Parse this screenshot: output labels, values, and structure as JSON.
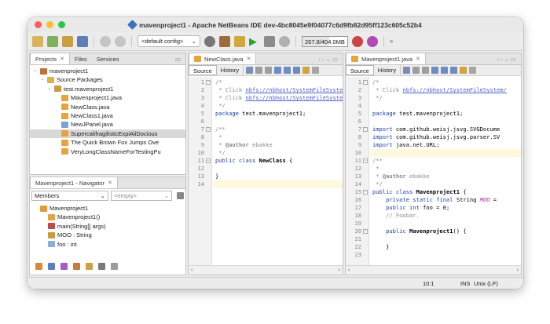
{
  "window": {
    "title": "mavenproject1 - Apache NetBeans IDE dev-4bc8045e9f04077c6d9fb82d95ff123c605c52b4",
    "traffic_colors": [
      "#ff5f57",
      "#febc2e",
      "#28c840"
    ]
  },
  "toolbar": {
    "config_label": "<default config>",
    "memory_label": "267.8/404.0MB",
    "more_label": "»"
  },
  "projects_panel": {
    "tabs": [
      {
        "label": "Projects",
        "close": "✕"
      },
      {
        "label": "Files"
      },
      {
        "label": "Services"
      }
    ],
    "tree": [
      {
        "label": "mavenproject1",
        "icon": "maven-project-icon",
        "depth": 0,
        "expanded": true
      },
      {
        "label": "Source Packages",
        "icon": "source-folder-icon",
        "depth": 1,
        "expanded": true
      },
      {
        "label": "test.mavenproject1",
        "icon": "package-icon",
        "depth": 2,
        "expanded": true
      },
      {
        "label": "Mavenproject1.java",
        "icon": "java-file-icon",
        "depth": 3
      },
      {
        "label": "NewClass.java",
        "icon": "java-file-icon",
        "depth": 3
      },
      {
        "label": "NewClass1.java",
        "icon": "java-file-icon",
        "depth": 3
      },
      {
        "label": "NewJPanel.java",
        "icon": "form-file-icon",
        "depth": 3
      },
      {
        "label": "SupercalifragilisticExpiAliDocious",
        "icon": "java-file-icon",
        "depth": 3,
        "selected": true
      },
      {
        "label": "The Quick Brown Fox Jumps Ove",
        "icon": "java-file-icon",
        "depth": 3
      },
      {
        "label": "VeryLongClassNameForTestingPu",
        "icon": "java-file-icon",
        "depth": 3
      }
    ]
  },
  "navigator_panel": {
    "title": "Mavenproject1 - Navigator",
    "close": "✕",
    "members_label": "Members",
    "empty_label": "<empty>",
    "tree": [
      {
        "label": "Mavenproject1",
        "icon": "class-icon",
        "depth": 0
      },
      {
        "label": "Mavenproject1()",
        "icon": "constructor-icon",
        "depth": 1
      },
      {
        "label": "main(String[] args)",
        "icon": "method-icon",
        "depth": 1
      },
      {
        "label": "MOO : String",
        "icon": "field-static-icon",
        "depth": 1
      },
      {
        "label": "foo : int",
        "icon": "field-icon",
        "depth": 1
      }
    ]
  },
  "editor_left": {
    "tab_label": "NewClass.java",
    "close": "✕",
    "source_label": "Source",
    "history_label": "History",
    "lines": [
      {
        "n": "1",
        "text": "/*"
      },
      {
        "n": "2",
        "text": " * Click nbfs://nbhost/SystemFileSystem/"
      },
      {
        "n": "3",
        "text": " * Click nbfs://nbhost/SystemFileSystem/"
      },
      {
        "n": "4",
        "text": " */"
      },
      {
        "n": "5",
        "text": "package test.mavenproject1;"
      },
      {
        "n": "6",
        "text": ""
      },
      {
        "n": "7",
        "text": "/**"
      },
      {
        "n": "8",
        "text": " *"
      },
      {
        "n": "9",
        "text": " * @author ebakke"
      },
      {
        "n": "10",
        "text": " */"
      },
      {
        "n": "11",
        "text": "public class NewClass {"
      },
      {
        "n": "12",
        "text": ""
      },
      {
        "n": "13",
        "text": "}"
      },
      {
        "n": "14",
        "text": ""
      }
    ]
  },
  "editor_right": {
    "tab_label": "Mavenproject1.java",
    "close": "✕",
    "source_label": "Source",
    "history_label": "History",
    "lines": [
      {
        "n": "1",
        "text": "/*"
      },
      {
        "n": "2",
        "text": " * Click nbfs://nbhost/SystemFileSystem/"
      },
      {
        "n": "3",
        "text": " */"
      },
      {
        "n": "4",
        "text": ""
      },
      {
        "n": "5",
        "text": "package test.mavenproject1;"
      },
      {
        "n": "6",
        "text": ""
      },
      {
        "n": "7",
        "text": "import com.github.weisj.jsvg.SVGDocume"
      },
      {
        "n": "8",
        "text": "import com.github.weisj.jsvg.parser.SV"
      },
      {
        "n": "9",
        "text": "import java.net.URL;"
      },
      {
        "n": "10",
        "text": ""
      },
      {
        "n": "11",
        "text": "/**"
      },
      {
        "n": "12",
        "text": " *"
      },
      {
        "n": "13",
        "text": " * @author ebakke"
      },
      {
        "n": "14",
        "text": " */"
      },
      {
        "n": "15",
        "text": "public class Mavenproject1 {"
      },
      {
        "n": "16",
        "text": "    private static final String MOO ="
      },
      {
        "n": "17",
        "text": "    public int foo = 0;"
      },
      {
        "n": "18",
        "text": "    // Foobar."
      },
      {
        "n": "19",
        "text": ""
      },
      {
        "n": "20",
        "text": "    public Mavenproject1() {"
      },
      {
        "n": "21",
        "text": ""
      },
      {
        "n": "22",
        "text": "    }"
      },
      {
        "n": "23",
        "text": ""
      }
    ]
  },
  "statusbar": {
    "position": "10:1",
    "mode": "INS",
    "line_ending": "Unix (LF)"
  }
}
